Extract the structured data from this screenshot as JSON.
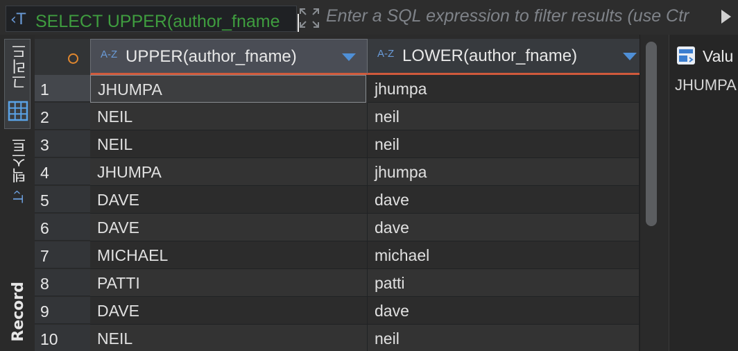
{
  "filter_bar": {
    "query_text": "SELECT UPPER(author_fname",
    "placeholder": "Enter a SQL expression to filter results (use Ctr"
  },
  "side_tabs": {
    "grid_label": "그리드",
    "text_label": "텍스트",
    "record_label": "Record"
  },
  "grid": {
    "columns": [
      {
        "type_badge": "A-Z",
        "title": "UPPER(author_fname)"
      },
      {
        "type_badge": "A-Z",
        "title": "LOWER(author_fname)"
      }
    ],
    "rows": [
      {
        "num": "1",
        "upper": "JHUMPA",
        "lower": "jhumpa"
      },
      {
        "num": "2",
        "upper": "NEIL",
        "lower": "neil"
      },
      {
        "num": "3",
        "upper": "NEIL",
        "lower": "neil"
      },
      {
        "num": "4",
        "upper": "JHUMPA",
        "lower": "jhumpa"
      },
      {
        "num": "5",
        "upper": "DAVE",
        "lower": "dave"
      },
      {
        "num": "6",
        "upper": "DAVE",
        "lower": "dave"
      },
      {
        "num": "7",
        "upper": "MICHAEL",
        "lower": "michael"
      },
      {
        "num": "8",
        "upper": "PATTI",
        "lower": "patti"
      },
      {
        "num": "9",
        "upper": "DAVE",
        "lower": "dave"
      },
      {
        "num": "10",
        "upper": "NEIL",
        "lower": "neil"
      }
    ]
  },
  "value_panel": {
    "title": "Valu",
    "value": "JHUMPA"
  },
  "colors": {
    "query_green": "#3f9d3f",
    "accent_blue": "#4f8fd6",
    "header_underline": "#d05a3c",
    "row_header_circle": "#e0872f"
  },
  "icons": [
    "text-filter-icon",
    "expand-icon",
    "run-arrow-icon",
    "grid-icon",
    "text-icon",
    "sort-desc-icon",
    "value-panel-icon"
  ]
}
